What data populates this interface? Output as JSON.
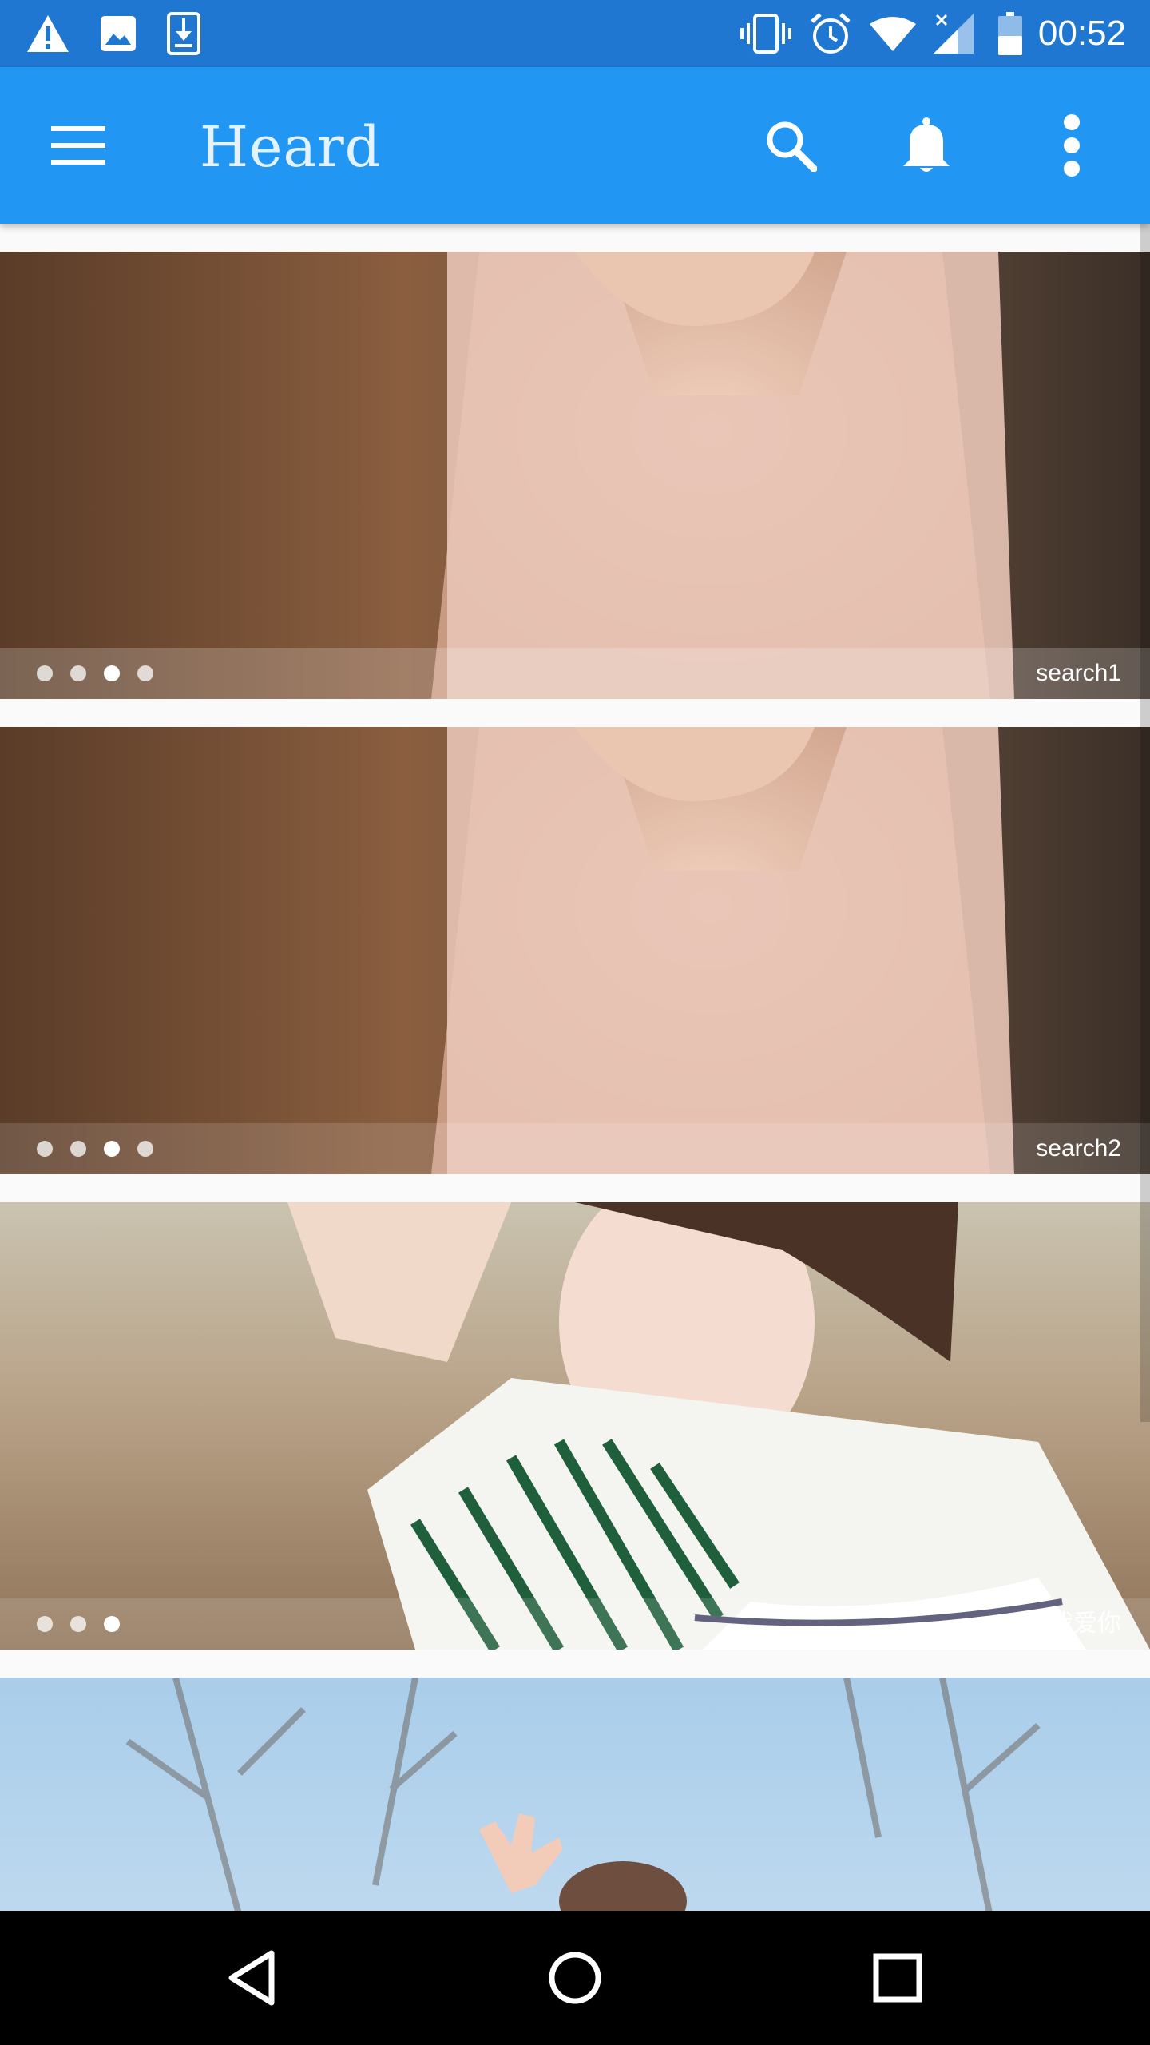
{
  "status_bar": {
    "time": "00:52",
    "left_icons": [
      "warning-icon",
      "image-icon",
      "download-icon"
    ],
    "right_icons": [
      "vibrate-icon",
      "alarm-icon",
      "wifi-icon",
      "signal-icon",
      "battery-icon"
    ]
  },
  "app_bar": {
    "title": "Heard",
    "actions": [
      "menu-icon",
      "search-icon",
      "bell-icon",
      "more-vert-icon"
    ]
  },
  "feed": {
    "banners": [
      {
        "caption": "search1",
        "dot_count": 4,
        "active_dot": 3
      },
      {
        "caption": "search2",
        "dot_count": 4,
        "active_dot": 3
      },
      {
        "caption": "我爱你",
        "dot_count": 3,
        "active_dot": 3
      },
      {
        "caption": "",
        "dot_count": 0,
        "active_dot": 0
      }
    ]
  },
  "nav_bar": {
    "buttons": [
      "back-icon",
      "home-icon",
      "recents-icon"
    ]
  },
  "colors": {
    "status_bar": "#1f77d2",
    "app_bar": "#2196f3",
    "background": "#fafafa"
  }
}
